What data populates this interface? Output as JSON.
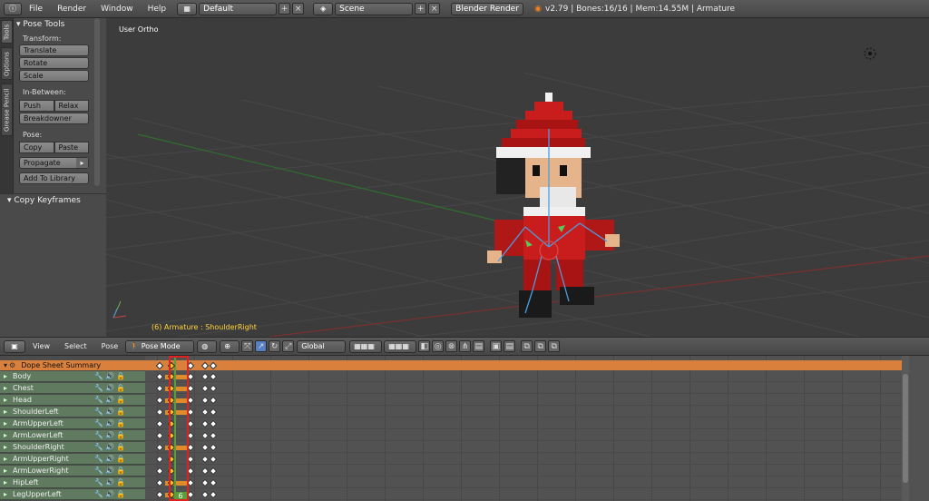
{
  "menubar": {
    "menus": [
      "File",
      "Render",
      "Window",
      "Help"
    ],
    "layout": "Default",
    "scene": "Scene",
    "engine": "Blender Render",
    "version": "v2.79 | Bones:16/16 | Mem:14.55M | Armature"
  },
  "tabs": [
    "Tools",
    "Options",
    "Grease Pencil"
  ],
  "tools": {
    "header": "Pose Tools",
    "transform_label": "Transform:",
    "translate": "Translate",
    "rotate": "Rotate",
    "scale": "Scale",
    "inbetween_label": "In-Between:",
    "push": "Push",
    "relax": "Relax",
    "breakdowner": "Breakdowner",
    "pose_label": "Pose:",
    "copy": "Copy",
    "paste": "Paste",
    "propagate": "Propagate",
    "add_to_library": "Add To Library",
    "copy_keyframes": "Copy Keyframes"
  },
  "viewport": {
    "view_label": "User Ortho",
    "status": "(6) Armature : ShoulderRight"
  },
  "header2": {
    "menus": [
      "View",
      "Select",
      "Pose"
    ],
    "mode": "Pose Mode",
    "orientation": "Global"
  },
  "dopesheet": {
    "summary": "Dope Sheet Summary",
    "current_frame": "6",
    "channels": [
      "Body",
      "Chest",
      "Head",
      "ShoulderLeft",
      "ArmUpperLeft",
      "ArmLowerLeft",
      "ShoulderRight",
      "ArmUpperRight",
      "ArmLowerRight",
      "HipLeft",
      "LegUpperLeft"
    ]
  },
  "colors": {
    "summary": "#d9803c",
    "channel": "#5f7a5f",
    "highlight_box": "#dd2222",
    "playhead": "#5a9e3a"
  }
}
